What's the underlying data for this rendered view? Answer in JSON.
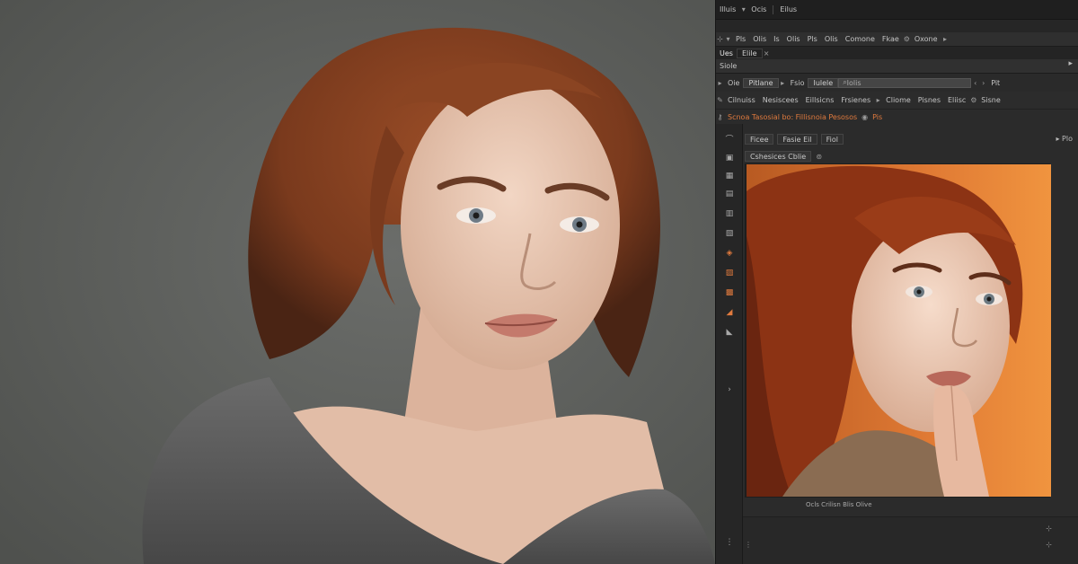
{
  "editor": {
    "titlebar": {
      "items": [
        "Illuis",
        "Ocis",
        "Eilus"
      ]
    },
    "optbar": {
      "items": [
        "Pls",
        "Olis",
        "Is",
        "Olis",
        "Pls",
        "Olis",
        "Comone",
        "Fkae",
        "Oxone"
      ],
      "more": "▸"
    },
    "filetabs": {
      "items": [
        "Ues",
        "Elile"
      ],
      "close": "×"
    },
    "panel_header": {
      "title": "Siole"
    },
    "controls": {
      "items": [
        "Oie",
        "Pitlane",
        "Fsio",
        "Iulele"
      ],
      "search_placeholder": "Iolis",
      "prev": "‹",
      "next": "›",
      "extra": "Pit"
    },
    "toolrow": {
      "items": [
        "Cilnuiss",
        "Nesiscees",
        "Eillsicns",
        "Frsienes",
        "Cliome",
        "Pisnes",
        "Eliisc",
        "Sisne"
      ]
    },
    "orange_row": {
      "text": "Scnoa Tasosial bo: Fillisnoia Pesosos",
      "tail": "Pis"
    },
    "doc_row1": {
      "items": [
        "Ficee",
        "Fasie Eil",
        "Fiol"
      ]
    },
    "doc_row2": {
      "items": [
        "Cshesices Cblie",
        "Eliite"
      ]
    },
    "right_top": "Plo",
    "status": "Ocls Crilisn Blis Olive"
  },
  "colors": {
    "accent": "#e07a3e",
    "panel": "#2b2b2b",
    "backdrop": "#5e605d"
  }
}
